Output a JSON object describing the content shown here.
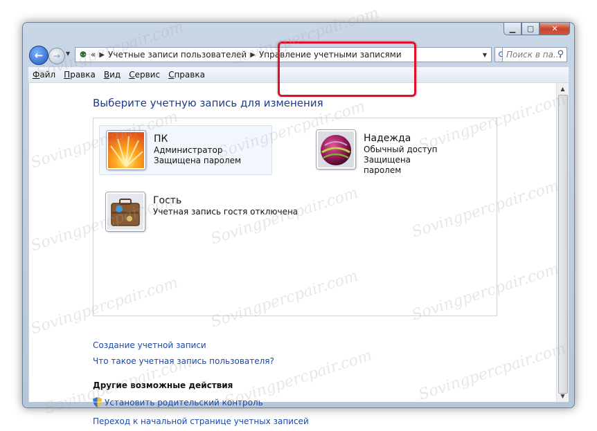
{
  "window": {
    "address_bar": {
      "crumbs": [
        "Учетные записи пользователей",
        "Управление учетными записями"
      ],
      "prefix": "«"
    },
    "search_placeholder": "Поиск в па...",
    "menu": [
      "Файл",
      "Правка",
      "Вид",
      "Сервис",
      "Справка"
    ]
  },
  "main": {
    "heading": "Выберите учетную запись для изменения",
    "accounts": [
      {
        "name": "ПК",
        "line1": "Администратор",
        "line2": "Защищена паролем",
        "avatar": "orange-flower"
      },
      {
        "name": "Надежда",
        "line1": "Обычный доступ",
        "line2": "Защищена паролем",
        "avatar": "striped-ball"
      },
      {
        "name": "Гость",
        "line1": "Учетная запись гостя отключена",
        "avatar": "suitcase"
      }
    ],
    "links": {
      "create": "Создание учетной записи",
      "what_is": "Что такое учетная запись пользователя?"
    },
    "other_actions": {
      "title": "Другие возможные действия",
      "parental": "Установить родительский контроль",
      "home": "Переход к начальной странице учетных записей"
    }
  },
  "watermark": "Sovingpercpair.com",
  "colors": {
    "link": "#1a48a8",
    "heading": "#1e3a8a",
    "highlight": "#e0102a"
  }
}
